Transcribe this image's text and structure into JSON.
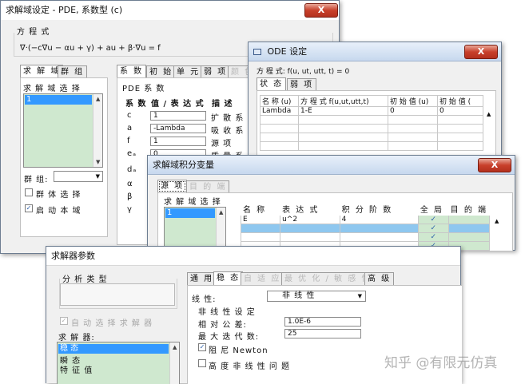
{
  "win1": {
    "title": "求解域设定 - PDE, 系数型 (c)",
    "close": "X",
    "eq_group": "方 程 式",
    "equation": "∇·(−c∇u − αu + γ) + au + β·∇u = f",
    "tabs": [
      "求 解 域",
      "群 组"
    ],
    "sel_group": "求 解 域 选 择",
    "domain_items": [
      "1"
    ],
    "group_label": "群 组:",
    "group_select_cb": "群 体 选 择",
    "activate_cb": "启 动 本 域",
    "coef_tabs": [
      "系 数",
      "初 始",
      "单 元",
      "弱 项",
      "颜 色"
    ],
    "pde_coef_label": "PDE 系 数",
    "coef_headers": [
      "系 数",
      "值 / 表 达 式",
      "描 述"
    ],
    "coef_rows": [
      {
        "sym": "c",
        "val": "1",
        "desc": "扩 散 系"
      },
      {
        "sym": "a",
        "val": "-Lambda",
        "desc": "吸 收 系"
      },
      {
        "sym": "f",
        "val": "1",
        "desc": "源 项"
      },
      {
        "sym": "eₐ",
        "val": "0",
        "desc": "质 量 系"
      },
      {
        "sym": "dₐ",
        "val": "",
        "desc": ""
      },
      {
        "sym": "α",
        "val": "",
        "desc": ""
      },
      {
        "sym": "β",
        "val": "",
        "desc": ""
      },
      {
        "sym": "γ",
        "val": "",
        "desc": ""
      }
    ]
  },
  "win2": {
    "title": "ODE 设定",
    "close": "X",
    "equation": "方 程 式: f(u, ut, utt, t) = 0",
    "tabs": [
      "状 态",
      "弱 项"
    ],
    "headers": [
      "名 称 (u)",
      "方 程 式 f(u,ut,utt,t)",
      "初 始 值 (u)",
      "初 始 值 ("
    ],
    "rows": [
      [
        "Lambda",
        "1-E",
        "0",
        "0"
      ]
    ]
  },
  "win3": {
    "title": "求解域积分变量",
    "close": "X",
    "tabs": [
      "源 项",
      "目 的 端"
    ],
    "sel_group": "求 解 域 选 择",
    "domain_items": [
      "1"
    ],
    "headers": [
      "名 称",
      "表 达 式",
      "积 分 阶 数",
      "全 局",
      "目 的 端"
    ],
    "rows": [
      [
        "E",
        "u^2",
        "4",
        "✓",
        ""
      ]
    ],
    "check": "✓"
  },
  "win4": {
    "title": "求解器参数",
    "analysis_group": "分 析 类 型",
    "auto_select": "自 动 选 择 求 解 器",
    "solver_label": "求 解 器:",
    "solver_items": [
      "稳 态",
      "瞬 态",
      "特 征 值"
    ],
    "tabs": [
      "通 用",
      "稳 态",
      "自 适 应",
      "最 优 化 / 敏 感 性",
      "高 级"
    ],
    "linearity_label": "线 性:",
    "linearity_value": "非 线 性",
    "nonlinear_group": "非 线 性 设 定",
    "rel_tol_label": "相 对 公 差:",
    "rel_tol_value": "1.0E-6",
    "max_iter_label": "最 大 迭 代 数:",
    "max_iter_value": "25",
    "damped_newton": "阻 尼 Newton",
    "highly_nonlinear": "高 度 非 线 性 问 题"
  },
  "watermark": "知乎 @有限元仿真"
}
